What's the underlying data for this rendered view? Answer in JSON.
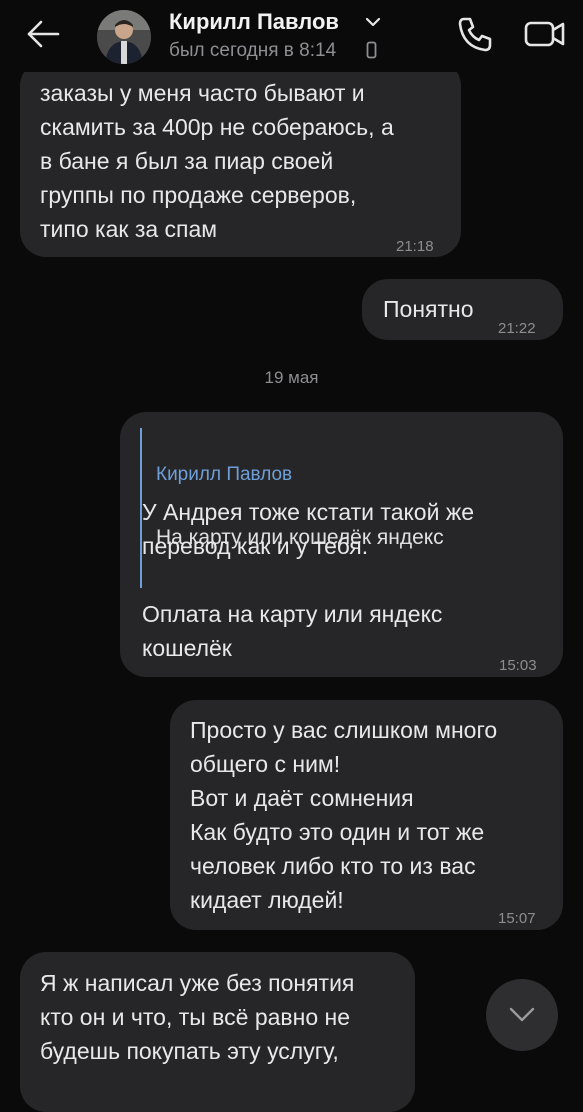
{
  "header": {
    "contact_name": "Кирилл Павлов",
    "last_seen": "был сегодня в 8:14"
  },
  "messages": [
    {
      "direction": "incoming",
      "text": "заказы у меня часто бывают и\nскамить за 400р не собераюсь, а\nв бане я был за пиар своей\nгруппы по продаже серверов,\nтипо как за спам",
      "time": "21:18"
    },
    {
      "direction": "outgoing",
      "text": "Понятно",
      "time": "21:22"
    },
    {
      "direction": "outgoing",
      "reply": {
        "author": "Кирилл Павлов",
        "text": "На карту или кошелёк яндекс"
      },
      "text": "У Андрея тоже кстати такой же\nперевод как и у тебя.\n\nОплата на карту или яндекс\nкошелёк",
      "time": "15:03"
    },
    {
      "direction": "outgoing",
      "text": "Просто у вас слишком много\nобщего с ним!\nВот и даёт сомнения\nКак будто это один и тот же\nчеловек либо кто то из вас\nкидает людей!",
      "time": "15:07"
    },
    {
      "direction": "incoming",
      "text": "Я ж написал уже без понятия\nкто он и что, ты всё равно не\nбудешь покупать эту услугу,",
      "time": ""
    }
  ],
  "date_separator": "19 мая",
  "icons": {
    "back": "arrow-left-icon",
    "chevron": "chevron-down-icon",
    "device": "phone-device-icon",
    "call": "phone-icon",
    "video": "video-camera-icon",
    "scroll": "chevron-down-icon"
  },
  "colors": {
    "background": "#0a0a0a",
    "bubble": "#262628",
    "accent": "#6f9fd8",
    "secondary_text": "#8d8d91"
  }
}
